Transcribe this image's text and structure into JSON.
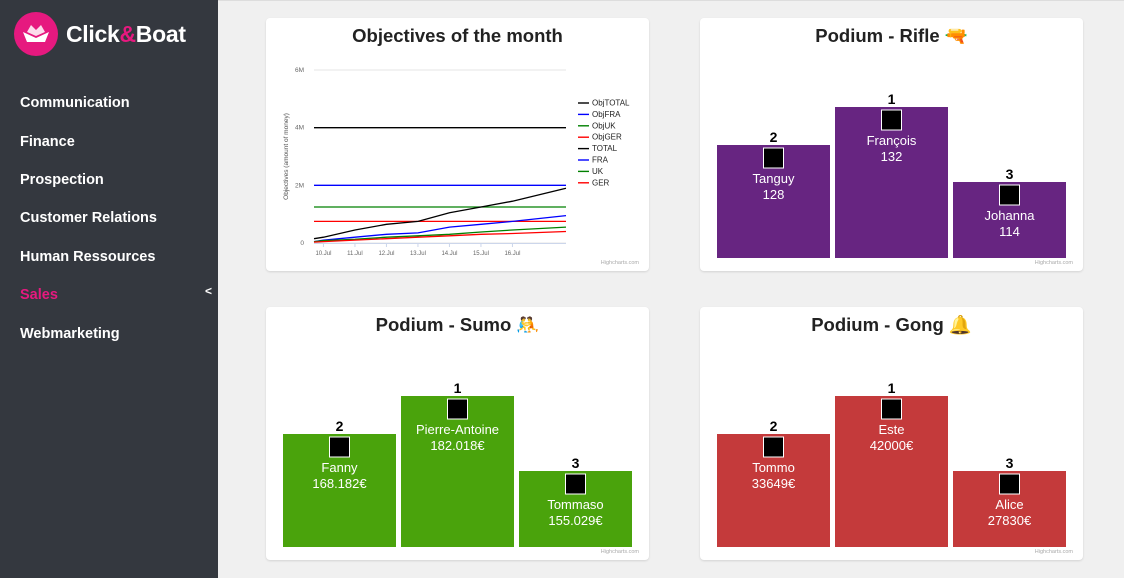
{
  "brand": {
    "prefix": "Click",
    "amp": "&",
    "suffix": "Boat",
    "color": "#e6197f"
  },
  "sidebar": {
    "items": [
      {
        "label": "Communication",
        "active": false
      },
      {
        "label": "Finance",
        "active": false
      },
      {
        "label": "Prospection",
        "active": false
      },
      {
        "label": "Customer Relations",
        "active": false
      },
      {
        "label": "Human Ressources",
        "active": false
      },
      {
        "label": "Sales",
        "active": true
      },
      {
        "label": "Webmarketing",
        "active": false
      }
    ],
    "collapse_icon": "<"
  },
  "objectives": {
    "title": "Objectives of the month",
    "credit": "Highcharts.com",
    "chart_data": {
      "type": "line",
      "title": "Objectives of the month",
      "xlabel": "",
      "ylabel": "Objectives (amount of money)",
      "categories": [
        "10.Jul",
        "11.Jul",
        "12.Jul",
        "13.Jul",
        "14.Jul",
        "15.Jul",
        "16.Jul"
      ],
      "x_range": [
        9.7,
        17.7
      ],
      "ylim": [
        0,
        6000000
      ],
      "yticks": [
        {
          "v": 0,
          "label": "0"
        },
        {
          "v": 2000000,
          "label": "2M"
        },
        {
          "v": 4000000,
          "label": "4M"
        },
        {
          "v": 6000000,
          "label": "6M"
        }
      ],
      "legend_position": "right",
      "series": [
        {
          "name": "ObjTOTAL",
          "color": "#000000",
          "x": [
            9.7,
            17.7
          ],
          "y": [
            4000000,
            4000000
          ]
        },
        {
          "name": "ObjFRA",
          "color": "#0000ff",
          "x": [
            9.7,
            17.7
          ],
          "y": [
            2000000,
            2000000
          ]
        },
        {
          "name": "ObjUK",
          "color": "#008000",
          "x": [
            9.7,
            17.7
          ],
          "y": [
            1250000,
            1250000
          ]
        },
        {
          "name": "ObjGER",
          "color": "#ff0000",
          "x": [
            9.7,
            17.7
          ],
          "y": [
            750000,
            750000
          ]
        },
        {
          "name": "TOTAL",
          "color": "#000000",
          "x": [
            9.7,
            10,
            11,
            12,
            13,
            14,
            15,
            16,
            17.7
          ],
          "y": [
            150000,
            200000,
            450000,
            650000,
            750000,
            1050000,
            1250000,
            1450000,
            1900000
          ]
        },
        {
          "name": "FRA",
          "color": "#0000ff",
          "x": [
            9.7,
            10,
            11,
            12,
            13,
            14,
            15,
            16,
            17.7
          ],
          "y": [
            50000,
            100000,
            200000,
            300000,
            350000,
            550000,
            650000,
            750000,
            950000
          ]
        },
        {
          "name": "UK",
          "color": "#008000",
          "x": [
            9.7,
            10,
            11,
            12,
            13,
            14,
            15,
            16,
            17.7
          ],
          "y": [
            50000,
            80000,
            130000,
            200000,
            250000,
            300000,
            380000,
            450000,
            550000
          ]
        },
        {
          "name": "GER",
          "color": "#ff0000",
          "x": [
            9.7,
            10,
            11,
            12,
            13,
            14,
            15,
            16,
            17.7
          ],
          "y": [
            30000,
            50000,
            100000,
            150000,
            200000,
            250000,
            300000,
            330000,
            400000
          ]
        }
      ]
    }
  },
  "podiums": [
    {
      "title": "Podium - Rifle",
      "icon": "🔫",
      "icon_name": "rifle-icon",
      "color": "#672581",
      "credit": "Highcharts.com",
      "chart_data": {
        "type": "bar",
        "entries": [
          {
            "rank": "2",
            "name": "Tanguy",
            "value": "128",
            "level": 2
          },
          {
            "rank": "1",
            "name": "François",
            "value": "132",
            "level": 1
          },
          {
            "rank": "3",
            "name": "Johanna",
            "value": "114",
            "level": 3
          }
        ]
      }
    },
    {
      "title": "Podium - Sumo",
      "icon": "🤼",
      "icon_name": "sumo-icon",
      "color": "#4aa30c",
      "credit": "Highcharts.com",
      "chart_data": {
        "type": "bar",
        "entries": [
          {
            "rank": "2",
            "name": "Fanny",
            "value": "168.182€",
            "level": 2
          },
          {
            "rank": "1",
            "name": "Pierre-Antoine",
            "value": "182.018€",
            "level": 1
          },
          {
            "rank": "3",
            "name": "Tommaso",
            "value": "155.029€",
            "level": 3
          }
        ]
      }
    },
    {
      "title": "Podium - Gong",
      "icon": "🔔",
      "icon_name": "gong-icon",
      "color": "#c43a3b",
      "credit": "Highcharts.com",
      "chart_data": {
        "type": "bar",
        "entries": [
          {
            "rank": "2",
            "name": "Tommo",
            "value": "33649€",
            "level": 2
          },
          {
            "rank": "1",
            "name": "Este",
            "value": "42000€",
            "level": 1
          },
          {
            "rank": "3",
            "name": "Alice",
            "value": "27830€",
            "level": 3
          }
        ]
      }
    }
  ]
}
